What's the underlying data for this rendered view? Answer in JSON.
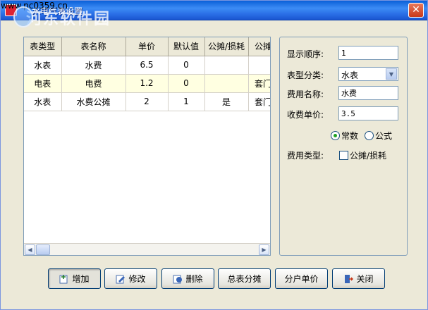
{
  "window": {
    "title": "水电气表设置",
    "watermark": "河东软件园",
    "watermark_url": "www.pc0359.cn",
    "close_label": "✕"
  },
  "grid": {
    "columns": [
      "表类型",
      "表名称",
      "单价",
      "默认值",
      "公摊/损耗",
      "公摊"
    ],
    "rows": [
      [
        "水表",
        "水费",
        "6.5",
        "0",
        "",
        ""
      ],
      [
        "电表",
        "电费",
        "1.2",
        "0",
        "",
        "套门"
      ],
      [
        "水表",
        "水费公摊",
        "2",
        "1",
        "是",
        "套门"
      ]
    ],
    "selected_row": 1
  },
  "form": {
    "order_label": "显示顺序:",
    "order_value": "1",
    "category_label": "表型分类:",
    "category_value": "水表",
    "name_label": "费用名称:",
    "name_value": "水费",
    "price_label": "收费单价:",
    "price_value": "3.5",
    "radio_constant": "常数",
    "radio_formula": "公式",
    "radio_selected": "常数",
    "type_label": "费用类型:",
    "type_checkbox": "公摊/损耗"
  },
  "buttons": {
    "add": "增加",
    "edit": "修改",
    "delete": "删除",
    "master_allocation": "总表分摊",
    "unit_price": "分户单价",
    "close": "关闭"
  }
}
